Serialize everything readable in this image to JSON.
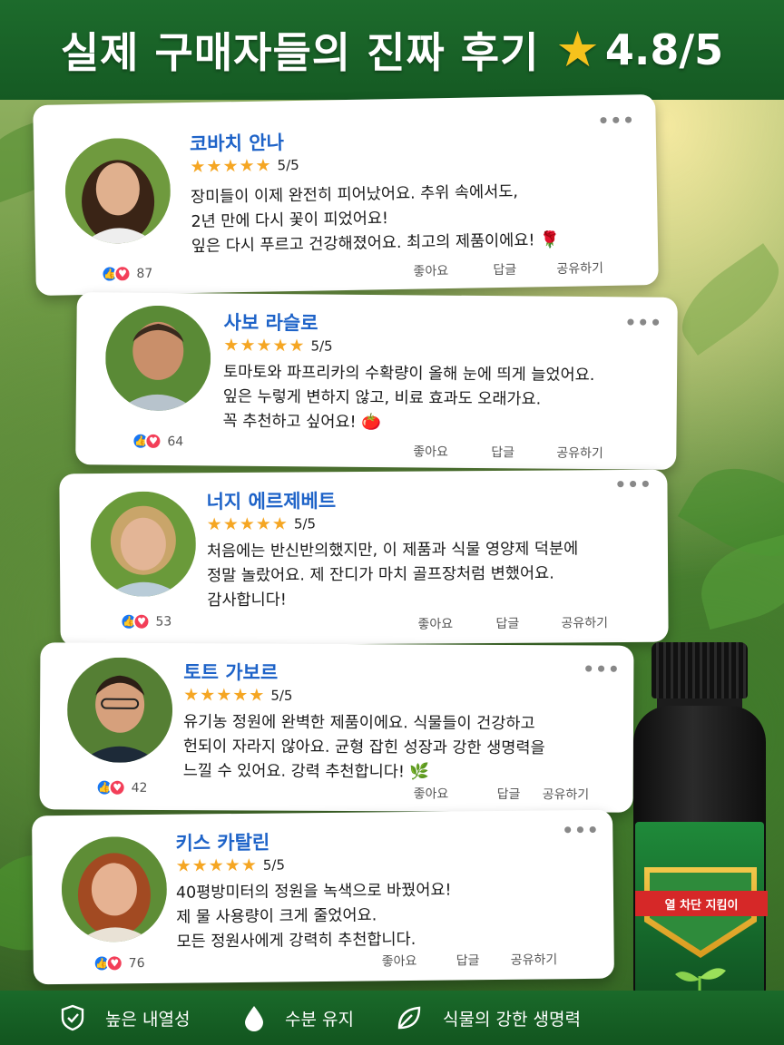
{
  "header": {
    "title": "실제 구매자들의 진짜 후기",
    "rating": "4.8/5"
  },
  "reviews": [
    {
      "name": "코바치 안나",
      "rating": "5/5",
      "lines": [
        "장미들이 이제 완전히 피어났어요. 추위 속에서도,",
        "2년 만에 다시 꽃이 피었어요!",
        "잎은 다시 푸르고 건강해졌어요. 최고의 제품이에요! 🌹"
      ],
      "reactions": "87",
      "actions": {
        "like": "좋아요",
        "reply": "답글",
        "share": "공유하기"
      }
    },
    {
      "name": "사보 라슬로",
      "rating": "5/5",
      "lines": [
        "토마토와 파프리카의 수확량이 올해 눈에 띄게 늘었어요.",
        "잎은 누렇게 변하지 않고, 비료 효과도 오래가요.",
        "꼭 추천하고 싶어요! 🍅"
      ],
      "reactions": "64",
      "actions": {
        "like": "좋아요",
        "reply": "답글",
        "share": "공유하기"
      }
    },
    {
      "name": "너지 에르제베트",
      "rating": "5/5",
      "lines": [
        "처음에는 반신반의했지만, 이 제품과 식물 영양제 덕분에",
        "정말 놀랐어요. 제 잔디가 마치 골프장처럼 변했어요.",
        "감사합니다!"
      ],
      "reactions": "53",
      "actions": {
        "like": "좋아요",
        "reply": "답글",
        "share": "공유하기"
      }
    },
    {
      "name": "토트 가보르",
      "rating": "5/5",
      "lines": [
        "유기농 정원에 완벽한 제품이에요. 식물들이 건강하고",
        "헌되이 자라지 않아요. 균형 잡힌 성장과 강한 생명력을",
        "느낄 수 있어요. 강력 추천합니다! 🌿"
      ],
      "reactions": "42",
      "actions": {
        "like": "좋아요",
        "reply": "답글",
        "share": "공유하기"
      }
    },
    {
      "name": "키스 카탈린",
      "rating": "5/5",
      "lines": [
        "40평방미터의 정원을 녹색으로 바꿨어요!",
        "제 물 사용량이 크게 줄었어요.",
        "모든 정원사에게 강력히 추천합니다."
      ],
      "reactions": "76",
      "actions": {
        "like": "좋아요",
        "reply": "답글",
        "share": "공유하기"
      }
    }
  ],
  "product": {
    "label_title": "열 차단 지킴이"
  },
  "features": [
    {
      "icon": "shield-check-icon",
      "label": "높은 내열성"
    },
    {
      "icon": "water-drop-icon",
      "label": "수분 유지"
    },
    {
      "icon": "leaf-icon",
      "label": "식물의 강한 생명력"
    }
  ],
  "colors": {
    "banner_green": "#1d6b2c",
    "name_blue": "#1e63c8",
    "star_gold": "#f5a623",
    "like_blue": "#1877f2",
    "heart_red": "#f33e58"
  }
}
